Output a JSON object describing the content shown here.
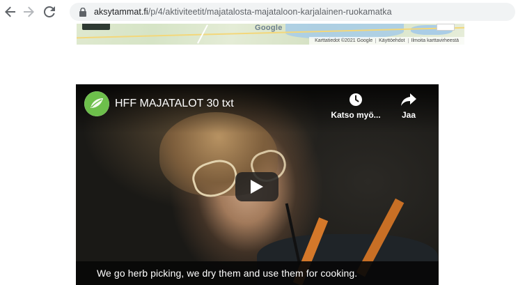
{
  "browser": {
    "url_host": "aksytammat.fi",
    "url_path": "/p/4/aktiviteetit/majatalosta-majataloon-karjalainen-ruokamatka"
  },
  "map": {
    "logo": "Google",
    "attribution": [
      "Karttatiedot ©2021 Google",
      "Käyttöehdot",
      "Ilmoita karttavirheestä"
    ]
  },
  "video": {
    "title": "HFF MAJATALOT 30 txt",
    "watch_later_label": "Katso myö...",
    "share_label": "Jaa",
    "caption": "We go herb picking, we dry them and use them for cooking."
  },
  "colors": {
    "accent_channel": "#6dbf4b",
    "video_bg": "#1b1916"
  }
}
